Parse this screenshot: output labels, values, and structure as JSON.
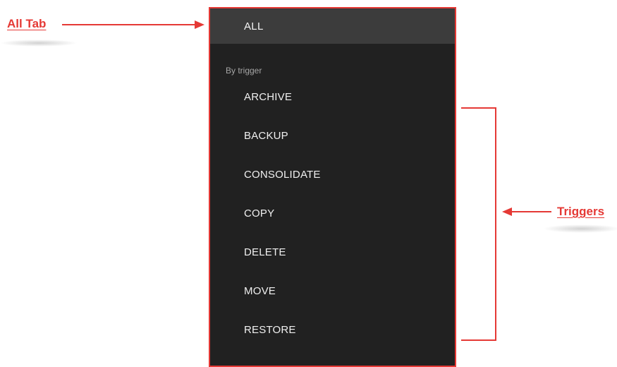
{
  "menu": {
    "all_tab_label": "ALL",
    "section_header": "By trigger",
    "triggers": [
      "ARCHIVE",
      "BACKUP",
      "CONSOLIDATE",
      "COPY",
      "DELETE",
      "MOVE",
      "RESTORE"
    ]
  },
  "annotations": {
    "all_tab": "All Tab",
    "triggers": "Triggers"
  },
  "colors": {
    "annotation_red": "#e53935",
    "panel_bg": "#212121",
    "selected_tab_bg": "#3c3c3c"
  }
}
